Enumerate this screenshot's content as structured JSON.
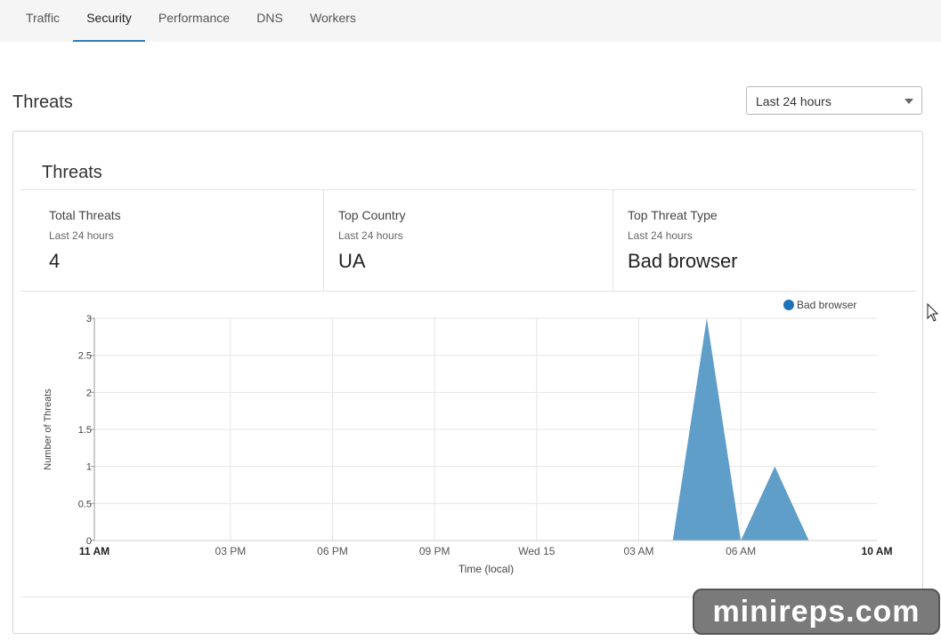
{
  "tabs": [
    {
      "label": "Traffic"
    },
    {
      "label": "Security",
      "active": true
    },
    {
      "label": "Performance"
    },
    {
      "label": "DNS"
    },
    {
      "label": "Workers"
    }
  ],
  "page_title": "Threats",
  "time_range": {
    "selected": "Last 24 hours"
  },
  "card": {
    "title": "Threats",
    "stats": [
      {
        "label": "Total Threats",
        "sub": "Last 24 hours",
        "value": "4"
      },
      {
        "label": "Top Country",
        "sub": "Last 24 hours",
        "value": "UA"
      },
      {
        "label": "Top Threat Type",
        "sub": "Last 24 hours",
        "value": "Bad browser"
      }
    ]
  },
  "chart_data": {
    "type": "area",
    "xlabel": "Time (local)",
    "ylabel": "Number of Threats",
    "x_ticks": [
      "11 AM",
      "03 PM",
      "06 PM",
      "09 PM",
      "Wed 15",
      "03 AM",
      "06 AM",
      "10 AM"
    ],
    "x_tick_hours": [
      0,
      4,
      7,
      10,
      13,
      16,
      19,
      23
    ],
    "ylim": [
      0,
      3
    ],
    "y_ticks": [
      "0",
      "0.5",
      "1",
      "1.5",
      "2",
      "2.5",
      "3"
    ],
    "grid": true,
    "legend_position": "top-right",
    "series": [
      {
        "name": "Bad browser",
        "color": "#5f9ec9",
        "legend_color": "#1f72b8",
        "points": [
          {
            "h": 17,
            "v": 0
          },
          {
            "h": 18,
            "v": 3
          },
          {
            "h": 19,
            "v": 0
          },
          {
            "h": 20,
            "v": 1
          },
          {
            "h": 21,
            "v": 0
          }
        ]
      }
    ]
  },
  "watermark": "minireps.com"
}
